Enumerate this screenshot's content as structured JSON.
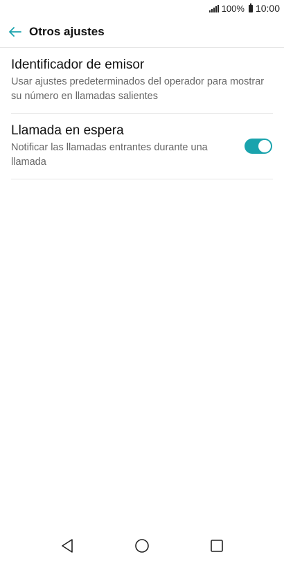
{
  "status_bar": {
    "battery": "100%",
    "time": "10:00",
    "icons": [
      "signal-icon",
      "battery-icon"
    ]
  },
  "header": {
    "title": "Otros ajustes",
    "back_icon": "arrow-left-icon",
    "accent_color": "#1aa3ad"
  },
  "settings": {
    "items": [
      {
        "title": "Identificador de emisor",
        "subtitle": "Usar ajustes predeterminados del operador para mostrar su número en llamadas salientes"
      },
      {
        "title": "Llamada en espera",
        "subtitle": "Notificar las llamadas entrantes durante una llamada",
        "toggle": "on"
      }
    ]
  },
  "nav_bar": {
    "icons": [
      "back-triangle-icon",
      "home-circle-icon",
      "recents-square-icon"
    ]
  }
}
